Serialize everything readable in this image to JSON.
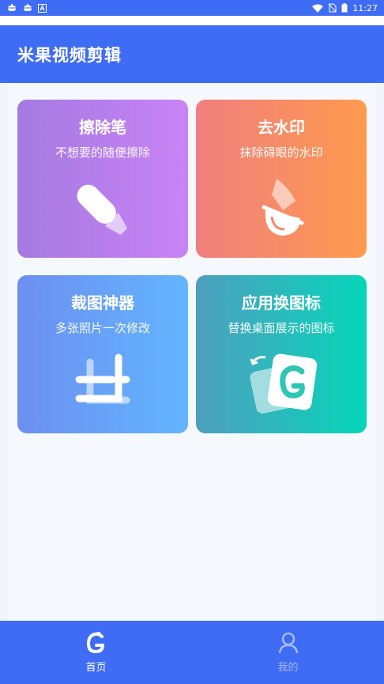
{
  "statusbar": {
    "time": "11:27",
    "left_icons": [
      "bug-icon",
      "bug-icon",
      "a-icon"
    ],
    "right_icons": [
      "wifi-icon",
      "no-sim-icon",
      "battery-icon"
    ]
  },
  "app": {
    "title": "米果视频剪辑",
    "primary_color": "#3f6cf5"
  },
  "cards": [
    {
      "title": "擦除笔",
      "subtitle": "不想要的随便擦除",
      "icon": "eraser-pen-icon"
    },
    {
      "title": "去水印",
      "subtitle": "抹除碍眼的水印",
      "icon": "watermark-remove-icon"
    },
    {
      "title": "裁图神器",
      "subtitle": "多张照片一次修改",
      "icon": "crop-icon"
    },
    {
      "title": "应用换图标",
      "subtitle": "替换桌面展示的图标",
      "icon": "app-icon-change-icon"
    }
  ],
  "tabs": [
    {
      "label": "首页",
      "icon": "home-logo-icon",
      "active": true
    },
    {
      "label": "我的",
      "icon": "person-icon",
      "active": false
    }
  ]
}
